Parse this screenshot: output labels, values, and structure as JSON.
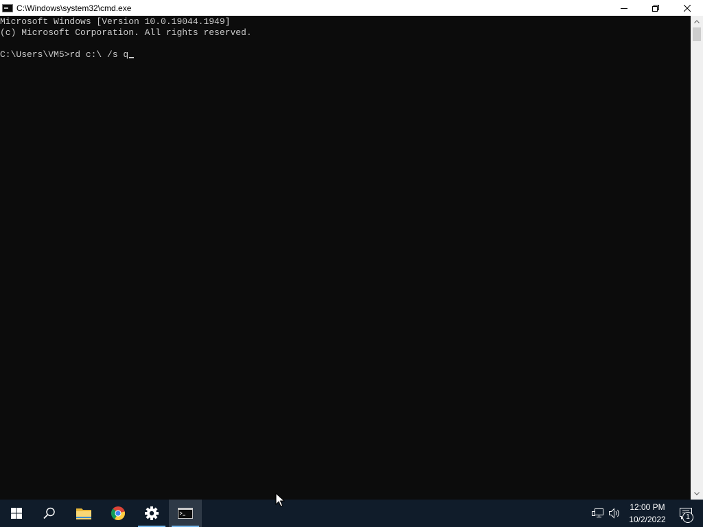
{
  "window": {
    "title": "C:\\Windows\\system32\\cmd.exe",
    "controls": [
      "minimize",
      "restore",
      "close"
    ]
  },
  "console": {
    "lines": [
      "Microsoft Windows [Version 10.0.19044.1949]",
      "(c) Microsoft Corporation. All rights reserved.",
      ""
    ],
    "prompt": "C:\\Users\\VM5>",
    "input": "rd c:\\ /s q"
  },
  "taskbar": {
    "items": [
      {
        "name": "start-button",
        "icon": "windows-logo-icon"
      },
      {
        "name": "search-button",
        "icon": "search-icon"
      },
      {
        "name": "file-explorer",
        "icon": "folder-icon"
      },
      {
        "name": "chrome",
        "icon": "chrome-icon"
      },
      {
        "name": "settings",
        "icon": "gear-icon",
        "running": true
      },
      {
        "name": "command-prompt",
        "icon": "cmd-icon",
        "running": true,
        "active": true
      }
    ],
    "tray_icons": [
      "network-icon",
      "volume-icon"
    ],
    "clock": {
      "time": "12:00 PM",
      "date": "10/2/2022"
    },
    "notifications": {
      "count": "1"
    }
  },
  "colors": {
    "console_bg": "#0c0c0c",
    "console_text": "#cccccc",
    "taskbar_bg": "#101c2a",
    "accent": "#76b9ed"
  }
}
